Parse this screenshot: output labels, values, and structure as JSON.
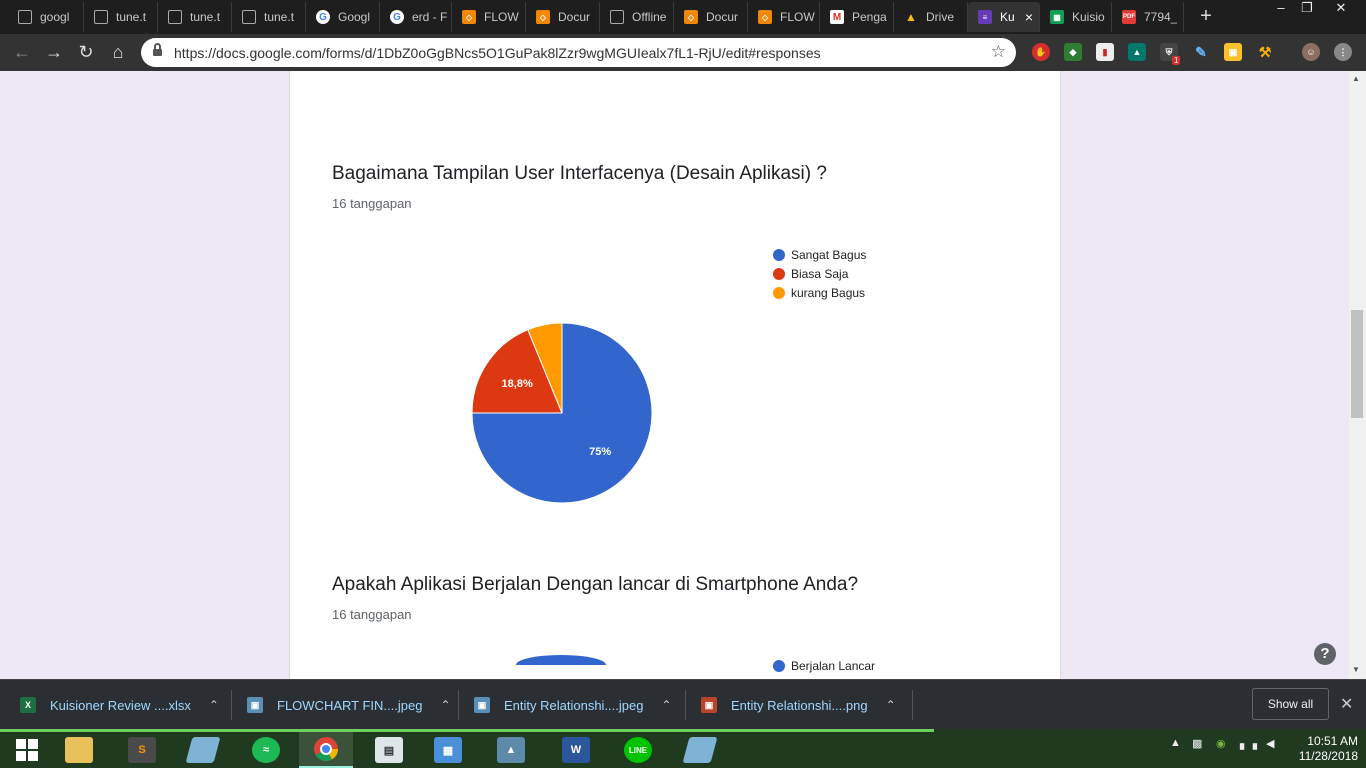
{
  "browser": {
    "tabs": [
      {
        "title": "googl",
        "icon": "doc-icon",
        "active": false
      },
      {
        "title": "tune.t",
        "icon": "doc-icon",
        "active": false
      },
      {
        "title": "tune.t",
        "icon": "doc-icon",
        "active": false
      },
      {
        "title": "tune.t",
        "icon": "doc-icon",
        "active": false
      },
      {
        "title": "Googl",
        "icon": "google-icon",
        "active": false
      },
      {
        "title": "erd - F",
        "icon": "google-icon",
        "active": false
      },
      {
        "title": "FLOW",
        "icon": "drawio-icon",
        "active": false
      },
      {
        "title": "Docur",
        "icon": "drawio-icon",
        "active": false
      },
      {
        "title": "Offline",
        "icon": "doc-icon",
        "active": false
      },
      {
        "title": "Docur",
        "icon": "drawio-icon",
        "active": false
      },
      {
        "title": "FLOW",
        "icon": "drawio-icon",
        "active": false
      },
      {
        "title": "Penga",
        "icon": "gmail-icon",
        "active": false
      },
      {
        "title": "Drive",
        "icon": "drive-icon",
        "active": false
      },
      {
        "title": "Ku",
        "icon": "forms-icon",
        "active": true
      },
      {
        "title": "Kuisio",
        "icon": "sheets-icon",
        "active": false
      },
      {
        "title": "7794_",
        "icon": "pdf-icon",
        "active": false
      }
    ],
    "url": "https://docs.google.com/forms/d/1DbZ0oGgBNcs5O1GuPak8lZzr9wgMGUIealx7fL1-RjU/edit#responses",
    "ext_badge": "1"
  },
  "form": {
    "question1": {
      "title": "Bagaimana Tampilan User Interfacenya (Desain Aplikasi) ?",
      "responses": "16 tanggapan"
    },
    "question2": {
      "title": "Apakah Aplikasi Berjalan Dengan lancar di Smartphone Anda?",
      "responses": "16 tanggapan",
      "legend_first": "Berjalan Lancar"
    }
  },
  "chart_data": {
    "type": "pie",
    "categories": [
      "Sangat Bagus",
      "Biasa Saja",
      "kurang Bagus"
    ],
    "values": [
      75,
      18.8,
      6.2
    ],
    "labels": [
      "75%",
      "18,8%",
      ""
    ],
    "colors": [
      "#3366cc",
      "#dc3912",
      "#ff9900"
    ],
    "legend_position": "right"
  },
  "downloads": [
    {
      "name": "Kuisioner Review ....xlsx",
      "icon": "excel-icon",
      "color": "#1d6f42"
    },
    {
      "name": "FLOWCHART FIN....jpeg",
      "icon": "image-icon",
      "color": "#5a8fb8"
    },
    {
      "name": "Entity Relationshi....jpeg",
      "icon": "image-icon",
      "color": "#5a8fb8"
    },
    {
      "name": "Entity Relationshi....png",
      "icon": "png-icon",
      "color": "#b8442c"
    }
  ],
  "shelf": {
    "show_all": "Show all"
  },
  "taskbar": {
    "time": "10:51 AM",
    "date": "11/28/2018"
  }
}
